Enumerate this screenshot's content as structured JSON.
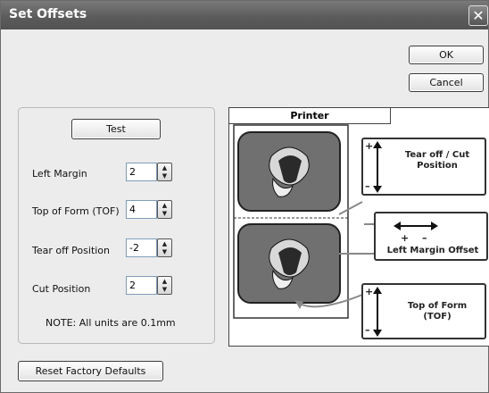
{
  "window": {
    "title": "Set Offsets",
    "close": "✕"
  },
  "buttons": {
    "ok": "OK",
    "cancel": "Cancel",
    "test": "Test",
    "reset": "Reset Factory Defaults"
  },
  "fields": {
    "left_margin": {
      "label": "Left Margin",
      "value": "2"
    },
    "tof": {
      "label": "Top of Form (TOF)",
      "value": "4"
    },
    "tear_off": {
      "label": "Tear off Position",
      "value": "-2"
    },
    "cut": {
      "label": "Cut Position",
      "value": "2"
    }
  },
  "note": "NOTE: All units are 0.1mm",
  "diagram": {
    "printer_label": "Printer",
    "tear_cut_line1": "Tear off / Cut",
    "tear_cut_line2": "Position",
    "left_margin_label": "Left Margin Offset",
    "tof_line1": "Top of Form",
    "tof_line2": "(TOF)",
    "plus": "+",
    "minus": "–"
  }
}
